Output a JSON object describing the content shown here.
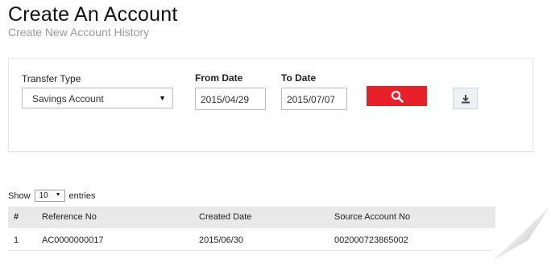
{
  "page": {
    "title": "Create An Account",
    "subtitle": "Create New Account History"
  },
  "filters": {
    "transfer_type_label": "Transfer Type",
    "transfer_type_value": "Savings Account",
    "from_date_label": "From Date",
    "from_date_value": "2015/04/29",
    "to_date_label": "To Date",
    "to_date_value": "2015/07/07",
    "search_icon": "search-icon",
    "download_icon": "download-icon",
    "accent_color": "#e8202a"
  },
  "table": {
    "show_label": "Show",
    "page_length": "10",
    "entries_label": "entries",
    "columns": [
      "#",
      "Reference No",
      "Created Date",
      "Source Account No"
    ],
    "rows": [
      [
        "1",
        "AC0000000017",
        "2015/06/30",
        "002000723865002"
      ]
    ]
  }
}
